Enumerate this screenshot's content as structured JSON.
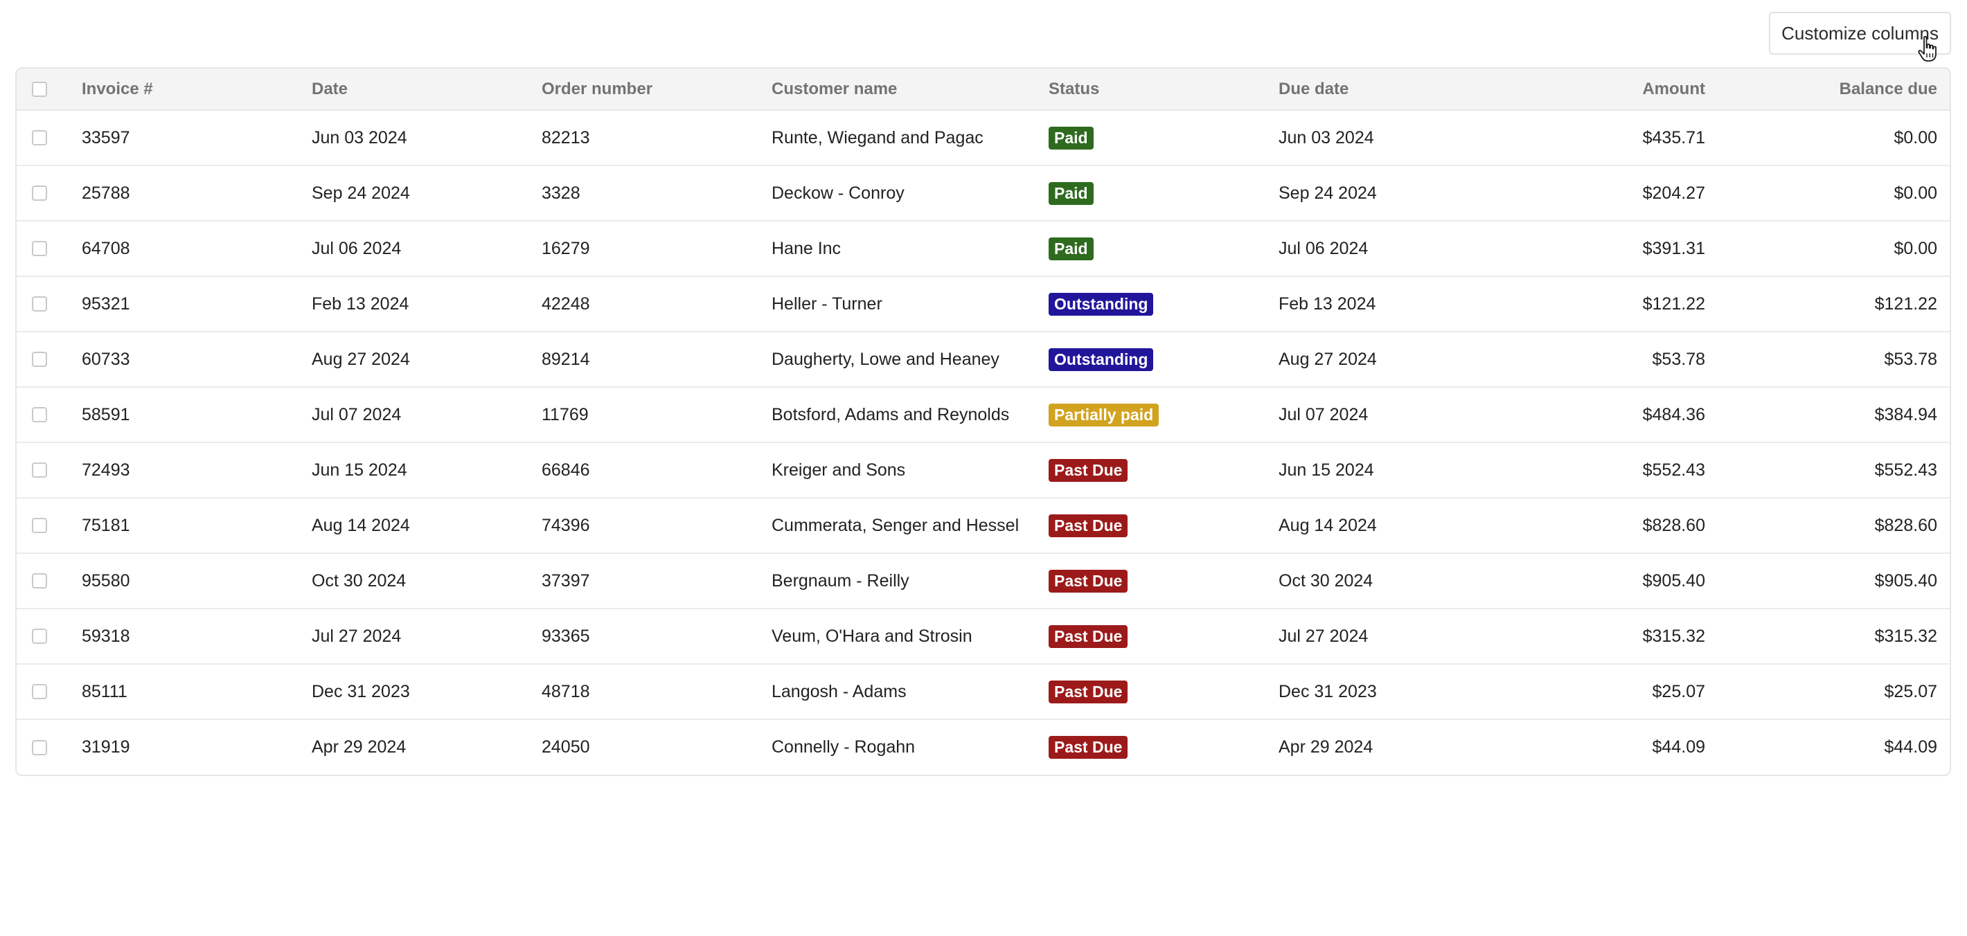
{
  "toolbar": {
    "customize_label": "Customize columns"
  },
  "columns": {
    "invoice": "Invoice #",
    "date": "Date",
    "order": "Order number",
    "customer": "Customer name",
    "status": "Status",
    "due": "Due date",
    "amount": "Amount",
    "balance": "Balance due"
  },
  "status_colors": {
    "Paid": "#2e6b1f",
    "Outstanding": "#21169a",
    "Partially paid": "#d2a31f",
    "Past Due": "#9c1a1a"
  },
  "rows": [
    {
      "invoice": "33597",
      "date": "Jun 03 2024",
      "order": "82213",
      "customer": "Runte, Wiegand and Pagac",
      "status": "Paid",
      "due": "Jun 03 2024",
      "amount": "$435.71",
      "balance": "$0.00"
    },
    {
      "invoice": "25788",
      "date": "Sep 24 2024",
      "order": "3328",
      "customer": "Deckow - Conroy",
      "status": "Paid",
      "due": "Sep 24 2024",
      "amount": "$204.27",
      "balance": "$0.00"
    },
    {
      "invoice": "64708",
      "date": "Jul 06 2024",
      "order": "16279",
      "customer": "Hane Inc",
      "status": "Paid",
      "due": "Jul 06 2024",
      "amount": "$391.31",
      "balance": "$0.00"
    },
    {
      "invoice": "95321",
      "date": "Feb 13 2024",
      "order": "42248",
      "customer": "Heller - Turner",
      "status": "Outstanding",
      "due": "Feb 13 2024",
      "amount": "$121.22",
      "balance": "$121.22"
    },
    {
      "invoice": "60733",
      "date": "Aug 27 2024",
      "order": "89214",
      "customer": "Daugherty, Lowe and Heaney",
      "status": "Outstanding",
      "due": "Aug 27 2024",
      "amount": "$53.78",
      "balance": "$53.78"
    },
    {
      "invoice": "58591",
      "date": "Jul 07 2024",
      "order": "11769",
      "customer": "Botsford, Adams and Reynolds",
      "status": "Partially paid",
      "due": "Jul 07 2024",
      "amount": "$484.36",
      "balance": "$384.94"
    },
    {
      "invoice": "72493",
      "date": "Jun 15 2024",
      "order": "66846",
      "customer": "Kreiger and Sons",
      "status": "Past Due",
      "due": "Jun 15 2024",
      "amount": "$552.43",
      "balance": "$552.43"
    },
    {
      "invoice": "75181",
      "date": "Aug 14 2024",
      "order": "74396",
      "customer": "Cummerata, Senger and Hessel",
      "status": "Past Due",
      "due": "Aug 14 2024",
      "amount": "$828.60",
      "balance": "$828.60"
    },
    {
      "invoice": "95580",
      "date": "Oct 30 2024",
      "order": "37397",
      "customer": "Bergnaum - Reilly",
      "status": "Past Due",
      "due": "Oct 30 2024",
      "amount": "$905.40",
      "balance": "$905.40"
    },
    {
      "invoice": "59318",
      "date": "Jul 27 2024",
      "order": "93365",
      "customer": "Veum, O'Hara and Strosin",
      "status": "Past Due",
      "due": "Jul 27 2024",
      "amount": "$315.32",
      "balance": "$315.32"
    },
    {
      "invoice": "85111",
      "date": "Dec 31 2023",
      "order": "48718",
      "customer": "Langosh - Adams",
      "status": "Past Due",
      "due": "Dec 31 2023",
      "amount": "$25.07",
      "balance": "$25.07"
    },
    {
      "invoice": "31919",
      "date": "Apr 29 2024",
      "order": "24050",
      "customer": "Connelly - Rogahn",
      "status": "Past Due",
      "due": "Apr 29 2024",
      "amount": "$44.09",
      "balance": "$44.09"
    }
  ]
}
